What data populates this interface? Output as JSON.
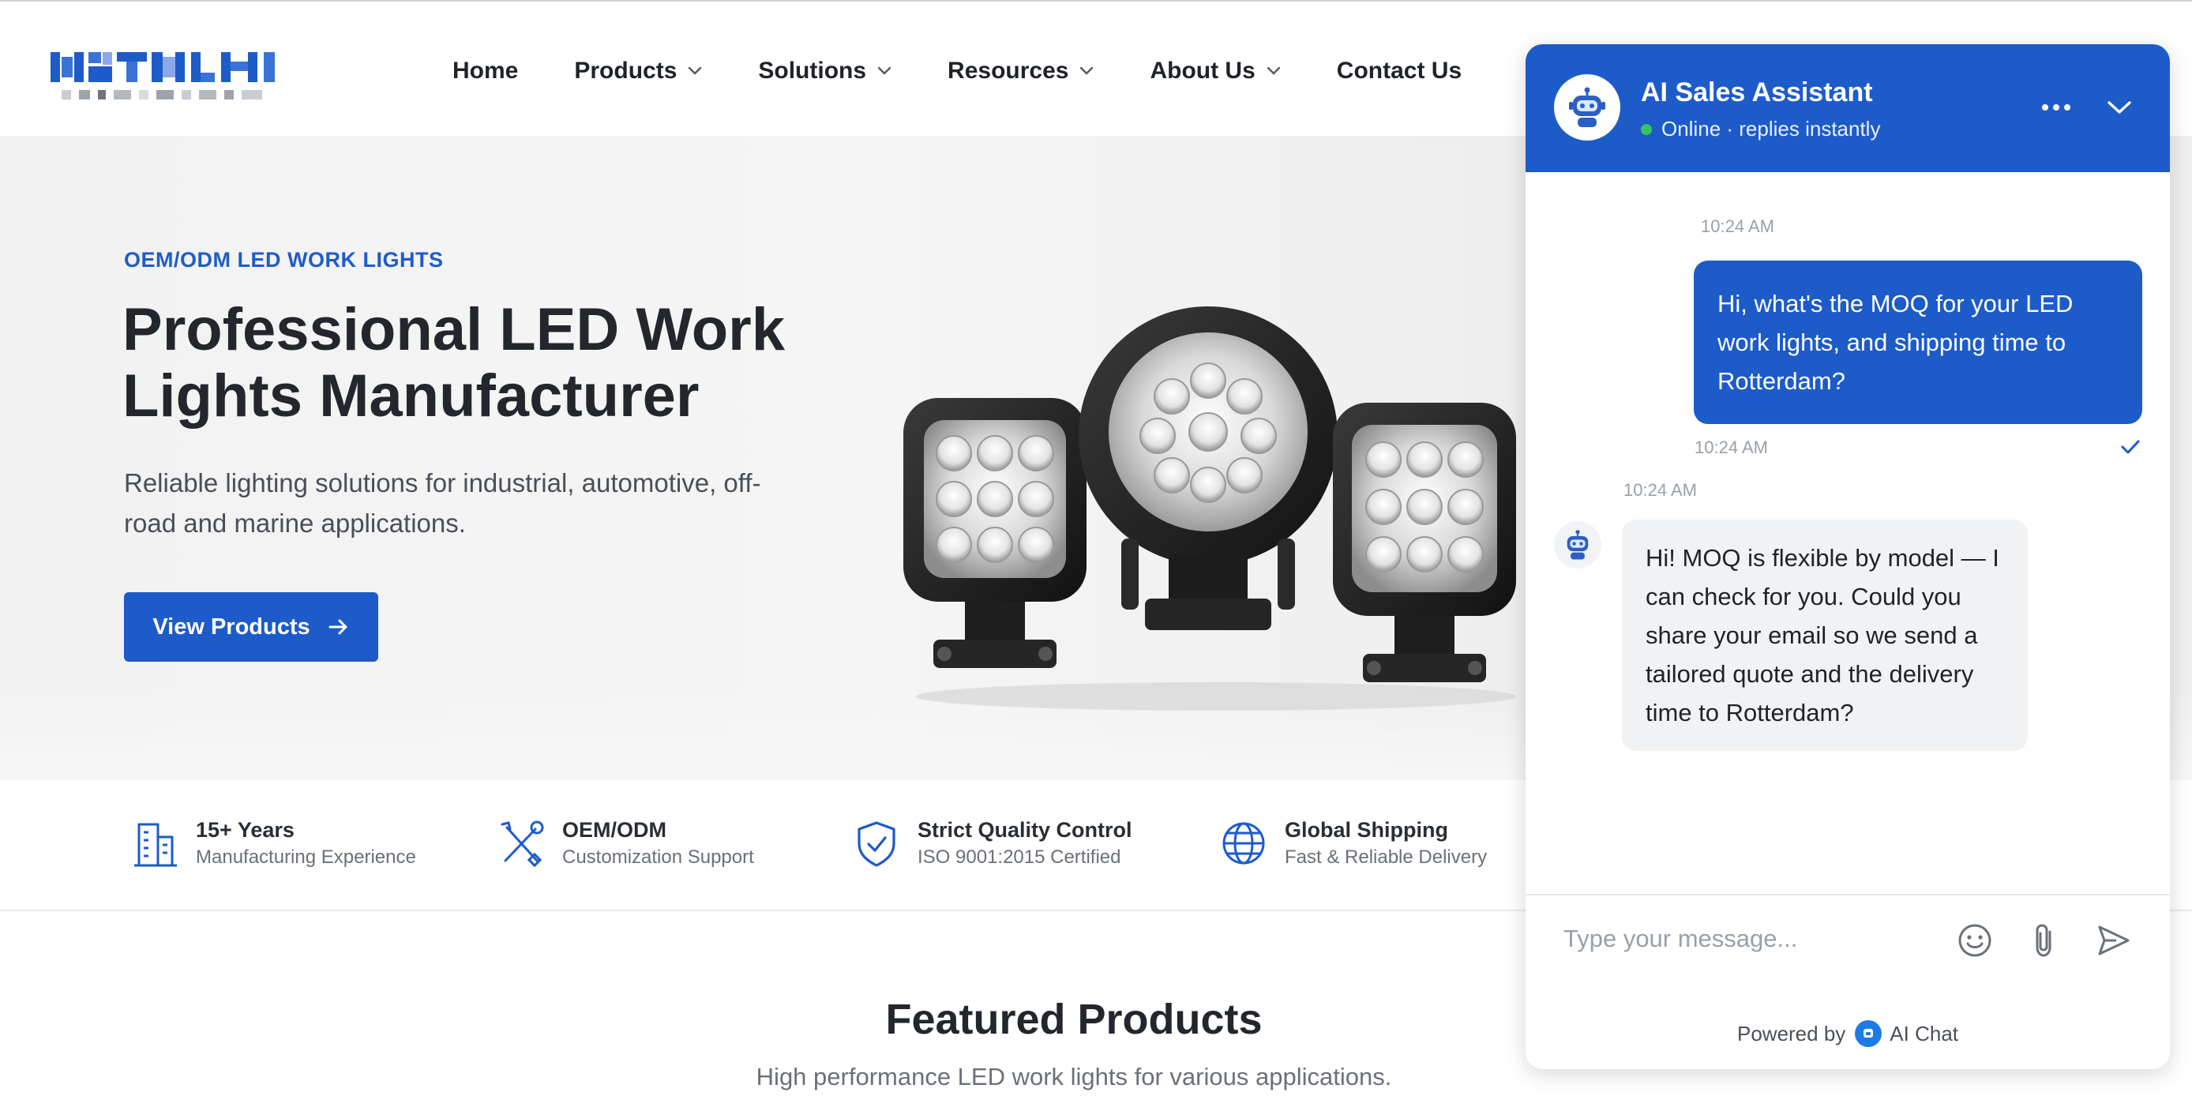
{
  "nav": {
    "items": [
      {
        "label": "Home",
        "has_dropdown": false
      },
      {
        "label": "Products",
        "has_dropdown": true
      },
      {
        "label": "Solutions",
        "has_dropdown": true
      },
      {
        "label": "Resources",
        "has_dropdown": true
      },
      {
        "label": "About Us",
        "has_dropdown": true
      },
      {
        "label": "Contact Us",
        "has_dropdown": false
      }
    ]
  },
  "hero": {
    "eyebrow": "OEM/ODM LED WORK LIGHTS",
    "title": "Professional LED Work Lights Manufacturer",
    "subtitle": "Reliable lighting solutions for industrial, automotive, off-road and marine applications.",
    "cta_label": "View Products"
  },
  "features": [
    {
      "icon": "building-icon",
      "title": "15+ Years",
      "subtitle": "Manufacturing Experience"
    },
    {
      "icon": "tools-icon",
      "title": "OEM/ODM",
      "subtitle": "Customization Support"
    },
    {
      "icon": "shield-check-icon",
      "title": "Strict Quality Control",
      "subtitle": "ISO 9001:2015 Certified"
    },
    {
      "icon": "globe-icon",
      "title": "Global Shipping",
      "subtitle": "Fast & Reliable Delivery"
    }
  ],
  "featured": {
    "title": "Featured Products",
    "subtitle": "High performance LED work lights for various applications."
  },
  "chat": {
    "title": "AI Sales Assistant",
    "status": "Online · replies instantly",
    "messages": [
      {
        "from": "user",
        "time_above": "10:24 AM",
        "text": "Hi, what's the MOQ for your LED work lights, and shipping time to Rotterdam?",
        "time_below": "10:24 AM"
      },
      {
        "from": "bot",
        "time": "10:24 AM",
        "text": "Hi! MOQ is flexible by model — I can check for you. Could you share your email so we send a tailored quote and the delivery time to Rotterdam?"
      }
    ],
    "input_placeholder": "Type your message...",
    "powered_prefix": "Powered by",
    "powered_brand": "AI Chat"
  },
  "colors": {
    "brand_blue": "#1d5bc9",
    "online_green": "#34c759"
  }
}
